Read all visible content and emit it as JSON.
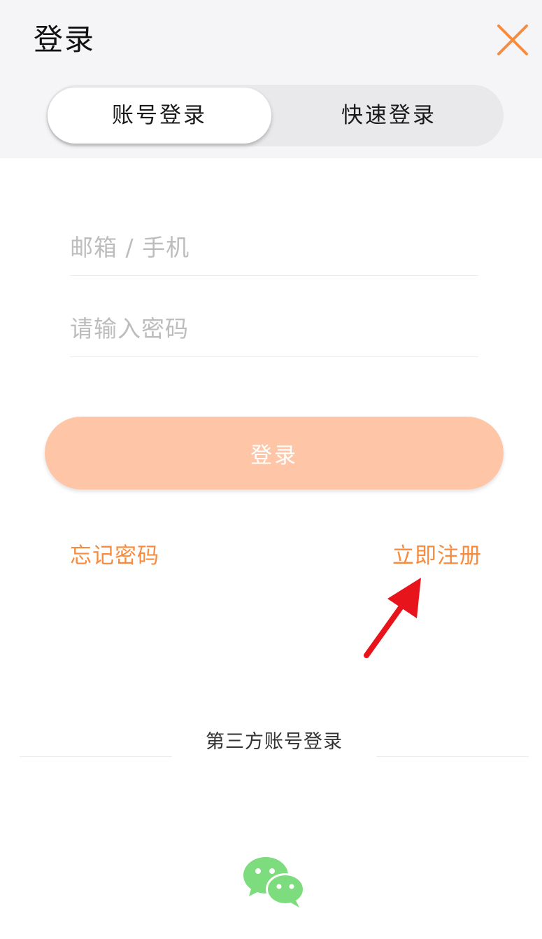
{
  "header": {
    "title": "登录",
    "close_icon": "close-icon"
  },
  "tabs": [
    {
      "label": "账号登录",
      "active": true
    },
    {
      "label": "快速登录",
      "active": false
    }
  ],
  "form": {
    "email_placeholder": "邮箱 / 手机",
    "email_value": "",
    "password_placeholder": "请输入密码",
    "password_value": "",
    "login_label": "登录"
  },
  "links": {
    "forgot_password": "忘记密码",
    "register": "立即注册"
  },
  "third_party": {
    "label": "第三方账号登录",
    "providers": [
      {
        "icon": "wechat-icon"
      }
    ]
  },
  "colors": {
    "accent": "#f88b3d",
    "button_bg": "#fec6a6",
    "header_bg": "#f5f5f7",
    "wechat": "#7ddc7e",
    "annotation_arrow": "#e8141c"
  }
}
